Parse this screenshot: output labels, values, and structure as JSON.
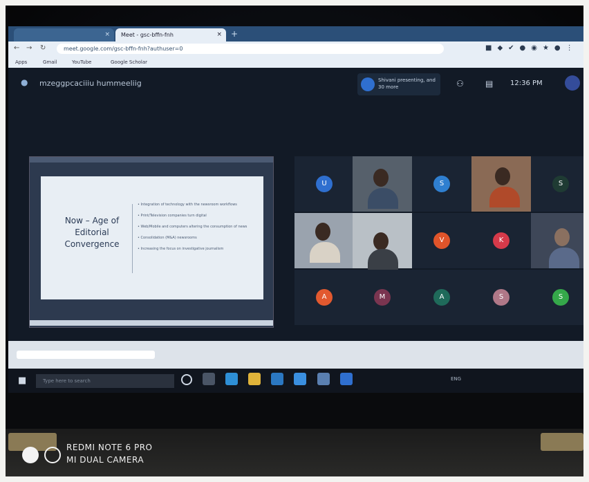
{
  "browser": {
    "tabs": [
      {
        "label": "",
        "active": false
      },
      {
        "label": "Meet - gsc-bffn-fnh",
        "active": true
      }
    ],
    "url": "meet.google.com/gsc-bffn-fnh?authuser=0",
    "bookmarks": [
      "Apps",
      "Gmail",
      "YouTube",
      "Google Scholar"
    ]
  },
  "meet": {
    "title": "mzeggpcaciiiu hummeeliig",
    "presenter_chip": "Shivani presenting, and 30 more",
    "clock": "12:36 PM"
  },
  "slide": {
    "heading_lines": [
      "Now – Age of",
      "Editorial",
      "Convergence"
    ],
    "bullets": [
      "Integration of technology with the newsroom workflows",
      "Print/Television companies turn digital",
      "Web/Mobile and computers altering the consumption of news",
      "Consolidation (M&A) newsrooms",
      "Increasing the focus on investigative journalism"
    ]
  },
  "participants": [
    {
      "initial": "U",
      "color": "#2f6fcf"
    },
    {
      "initial": "S",
      "color": "#2f7fd0"
    },
    {
      "initial": "S",
      "color": "#1f3b33"
    },
    {
      "initial": "V",
      "color": "#e0542a"
    },
    {
      "initial": "K",
      "color": "#d63a4a"
    },
    {
      "initial": "A",
      "color": "#e2592f"
    },
    {
      "initial": "M",
      "color": "#7a3550"
    },
    {
      "initial": "A",
      "color": "#1f6a5a"
    },
    {
      "initial": "S",
      "color": "#b07888"
    },
    {
      "initial": "S",
      "color": "#35a84a"
    }
  ],
  "taskbar": {
    "search_placeholder": "Type here to search",
    "tray_text": "ENG"
  },
  "watermark": {
    "line1": "REDMI NOTE 6 PRO",
    "line2": "MI DUAL CAMERA"
  }
}
